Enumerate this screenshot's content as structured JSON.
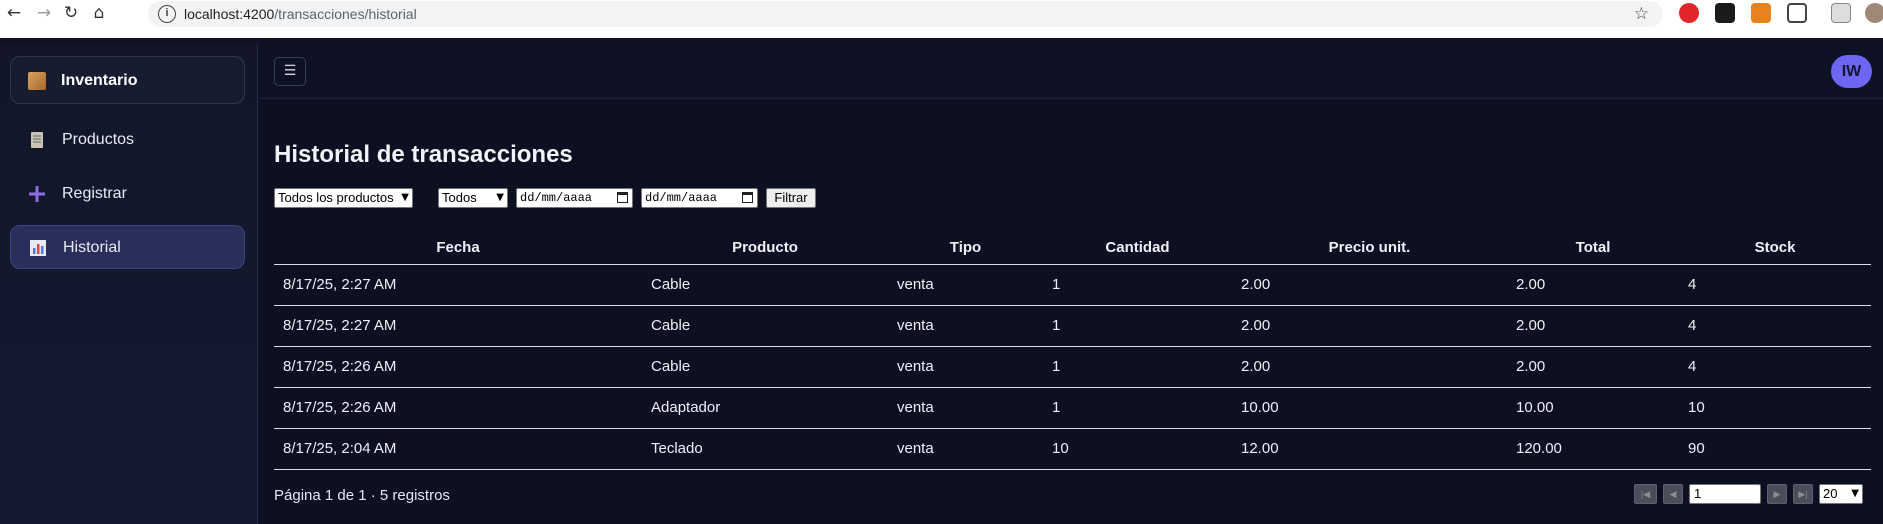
{
  "browser": {
    "url_host": "localhost:4200",
    "url_path": "/transacciones/historial"
  },
  "sidebar": {
    "brand": "Inventario",
    "items": [
      {
        "label": "Productos",
        "icon": "document-icon"
      },
      {
        "label": "Registrar",
        "icon": "plus-icon"
      },
      {
        "label": "Historial",
        "icon": "bar-chart-icon",
        "active": true
      }
    ]
  },
  "topbar": {
    "menu_icon": "☰",
    "avatar_initials": "IW"
  },
  "page": {
    "title": "Historial de transacciones"
  },
  "filters": {
    "product_select": "Todos los productos",
    "type_select": "Todos",
    "date_from_placeholder": "dd/mm/aaaa",
    "date_to_placeholder": "dd/mm/aaaa",
    "filter_button": "Filtrar"
  },
  "table": {
    "headers": [
      "Fecha",
      "Producto",
      "Tipo",
      "Cantidad",
      "Precio unit.",
      "Total",
      "Stock"
    ],
    "rows": [
      [
        "8/17/25, 2:27 AM",
        "Cable",
        "venta",
        "1",
        "2.00",
        "2.00",
        "4"
      ],
      [
        "8/17/25, 2:27 AM",
        "Cable",
        "venta",
        "1",
        "2.00",
        "2.00",
        "4"
      ],
      [
        "8/17/25, 2:26 AM",
        "Cable",
        "venta",
        "1",
        "2.00",
        "2.00",
        "4"
      ],
      [
        "8/17/25, 2:26 AM",
        "Adaptador",
        "venta",
        "1",
        "10.00",
        "10.00",
        "10"
      ],
      [
        "8/17/25, 2:04 AM",
        "Teclado",
        "venta",
        "10",
        "12.00",
        "120.00",
        "90"
      ]
    ]
  },
  "pagination": {
    "summary": "Página 1 de 1 · 5 registros",
    "page_input": "1",
    "page_size": "20"
  },
  "colors": {
    "background": "#0d1020",
    "sidebar_active": "#2a2e5a",
    "avatar": "#6d66f0"
  }
}
